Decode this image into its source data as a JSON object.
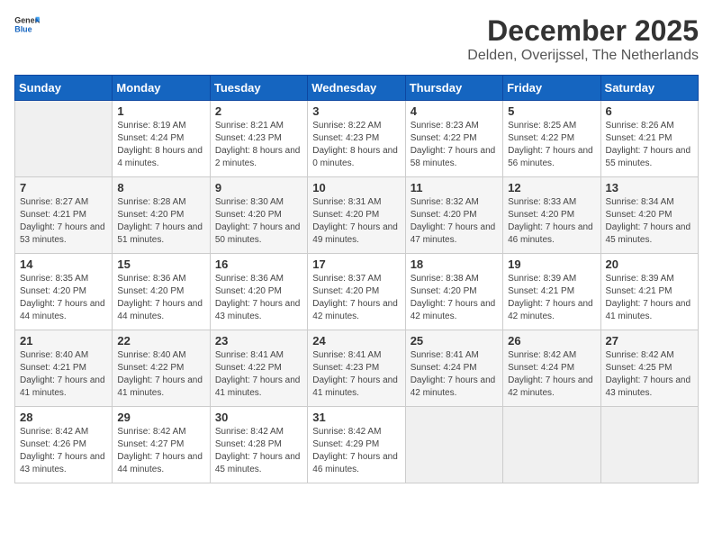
{
  "header": {
    "logo": {
      "general": "General",
      "blue": "Blue"
    },
    "title": "December 2025",
    "location": "Delden, Overijssel, The Netherlands"
  },
  "weekdays": [
    "Sunday",
    "Monday",
    "Tuesday",
    "Wednesday",
    "Thursday",
    "Friday",
    "Saturday"
  ],
  "weeks": [
    [
      {
        "day": "",
        "empty": true
      },
      {
        "day": "1",
        "sunrise": "Sunrise: 8:19 AM",
        "sunset": "Sunset: 4:24 PM",
        "daylight": "Daylight: 8 hours and 4 minutes."
      },
      {
        "day": "2",
        "sunrise": "Sunrise: 8:21 AM",
        "sunset": "Sunset: 4:23 PM",
        "daylight": "Daylight: 8 hours and 2 minutes."
      },
      {
        "day": "3",
        "sunrise": "Sunrise: 8:22 AM",
        "sunset": "Sunset: 4:23 PM",
        "daylight": "Daylight: 8 hours and 0 minutes."
      },
      {
        "day": "4",
        "sunrise": "Sunrise: 8:23 AM",
        "sunset": "Sunset: 4:22 PM",
        "daylight": "Daylight: 7 hours and 58 minutes."
      },
      {
        "day": "5",
        "sunrise": "Sunrise: 8:25 AM",
        "sunset": "Sunset: 4:22 PM",
        "daylight": "Daylight: 7 hours and 56 minutes."
      },
      {
        "day": "6",
        "sunrise": "Sunrise: 8:26 AM",
        "sunset": "Sunset: 4:21 PM",
        "daylight": "Daylight: 7 hours and 55 minutes."
      }
    ],
    [
      {
        "day": "7",
        "sunrise": "Sunrise: 8:27 AM",
        "sunset": "Sunset: 4:21 PM",
        "daylight": "Daylight: 7 hours and 53 minutes."
      },
      {
        "day": "8",
        "sunrise": "Sunrise: 8:28 AM",
        "sunset": "Sunset: 4:20 PM",
        "daylight": "Daylight: 7 hours and 51 minutes."
      },
      {
        "day": "9",
        "sunrise": "Sunrise: 8:30 AM",
        "sunset": "Sunset: 4:20 PM",
        "daylight": "Daylight: 7 hours and 50 minutes."
      },
      {
        "day": "10",
        "sunrise": "Sunrise: 8:31 AM",
        "sunset": "Sunset: 4:20 PM",
        "daylight": "Daylight: 7 hours and 49 minutes."
      },
      {
        "day": "11",
        "sunrise": "Sunrise: 8:32 AM",
        "sunset": "Sunset: 4:20 PM",
        "daylight": "Daylight: 7 hours and 47 minutes."
      },
      {
        "day": "12",
        "sunrise": "Sunrise: 8:33 AM",
        "sunset": "Sunset: 4:20 PM",
        "daylight": "Daylight: 7 hours and 46 minutes."
      },
      {
        "day": "13",
        "sunrise": "Sunrise: 8:34 AM",
        "sunset": "Sunset: 4:20 PM",
        "daylight": "Daylight: 7 hours and 45 minutes."
      }
    ],
    [
      {
        "day": "14",
        "sunrise": "Sunrise: 8:35 AM",
        "sunset": "Sunset: 4:20 PM",
        "daylight": "Daylight: 7 hours and 44 minutes."
      },
      {
        "day": "15",
        "sunrise": "Sunrise: 8:36 AM",
        "sunset": "Sunset: 4:20 PM",
        "daylight": "Daylight: 7 hours and 44 minutes."
      },
      {
        "day": "16",
        "sunrise": "Sunrise: 8:36 AM",
        "sunset": "Sunset: 4:20 PM",
        "daylight": "Daylight: 7 hours and 43 minutes."
      },
      {
        "day": "17",
        "sunrise": "Sunrise: 8:37 AM",
        "sunset": "Sunset: 4:20 PM",
        "daylight": "Daylight: 7 hours and 42 minutes."
      },
      {
        "day": "18",
        "sunrise": "Sunrise: 8:38 AM",
        "sunset": "Sunset: 4:20 PM",
        "daylight": "Daylight: 7 hours and 42 minutes."
      },
      {
        "day": "19",
        "sunrise": "Sunrise: 8:39 AM",
        "sunset": "Sunset: 4:21 PM",
        "daylight": "Daylight: 7 hours and 42 minutes."
      },
      {
        "day": "20",
        "sunrise": "Sunrise: 8:39 AM",
        "sunset": "Sunset: 4:21 PM",
        "daylight": "Daylight: 7 hours and 41 minutes."
      }
    ],
    [
      {
        "day": "21",
        "sunrise": "Sunrise: 8:40 AM",
        "sunset": "Sunset: 4:21 PM",
        "daylight": "Daylight: 7 hours and 41 minutes."
      },
      {
        "day": "22",
        "sunrise": "Sunrise: 8:40 AM",
        "sunset": "Sunset: 4:22 PM",
        "daylight": "Daylight: 7 hours and 41 minutes."
      },
      {
        "day": "23",
        "sunrise": "Sunrise: 8:41 AM",
        "sunset": "Sunset: 4:22 PM",
        "daylight": "Daylight: 7 hours and 41 minutes."
      },
      {
        "day": "24",
        "sunrise": "Sunrise: 8:41 AM",
        "sunset": "Sunset: 4:23 PM",
        "daylight": "Daylight: 7 hours and 41 minutes."
      },
      {
        "day": "25",
        "sunrise": "Sunrise: 8:41 AM",
        "sunset": "Sunset: 4:24 PM",
        "daylight": "Daylight: 7 hours and 42 minutes."
      },
      {
        "day": "26",
        "sunrise": "Sunrise: 8:42 AM",
        "sunset": "Sunset: 4:24 PM",
        "daylight": "Daylight: 7 hours and 42 minutes."
      },
      {
        "day": "27",
        "sunrise": "Sunrise: 8:42 AM",
        "sunset": "Sunset: 4:25 PM",
        "daylight": "Daylight: 7 hours and 43 minutes."
      }
    ],
    [
      {
        "day": "28",
        "sunrise": "Sunrise: 8:42 AM",
        "sunset": "Sunset: 4:26 PM",
        "daylight": "Daylight: 7 hours and 43 minutes."
      },
      {
        "day": "29",
        "sunrise": "Sunrise: 8:42 AM",
        "sunset": "Sunset: 4:27 PM",
        "daylight": "Daylight: 7 hours and 44 minutes."
      },
      {
        "day": "30",
        "sunrise": "Sunrise: 8:42 AM",
        "sunset": "Sunset: 4:28 PM",
        "daylight": "Daylight: 7 hours and 45 minutes."
      },
      {
        "day": "31",
        "sunrise": "Sunrise: 8:42 AM",
        "sunset": "Sunset: 4:29 PM",
        "daylight": "Daylight: 7 hours and 46 minutes."
      },
      {
        "day": "",
        "empty": true
      },
      {
        "day": "",
        "empty": true
      },
      {
        "day": "",
        "empty": true
      }
    ]
  ]
}
